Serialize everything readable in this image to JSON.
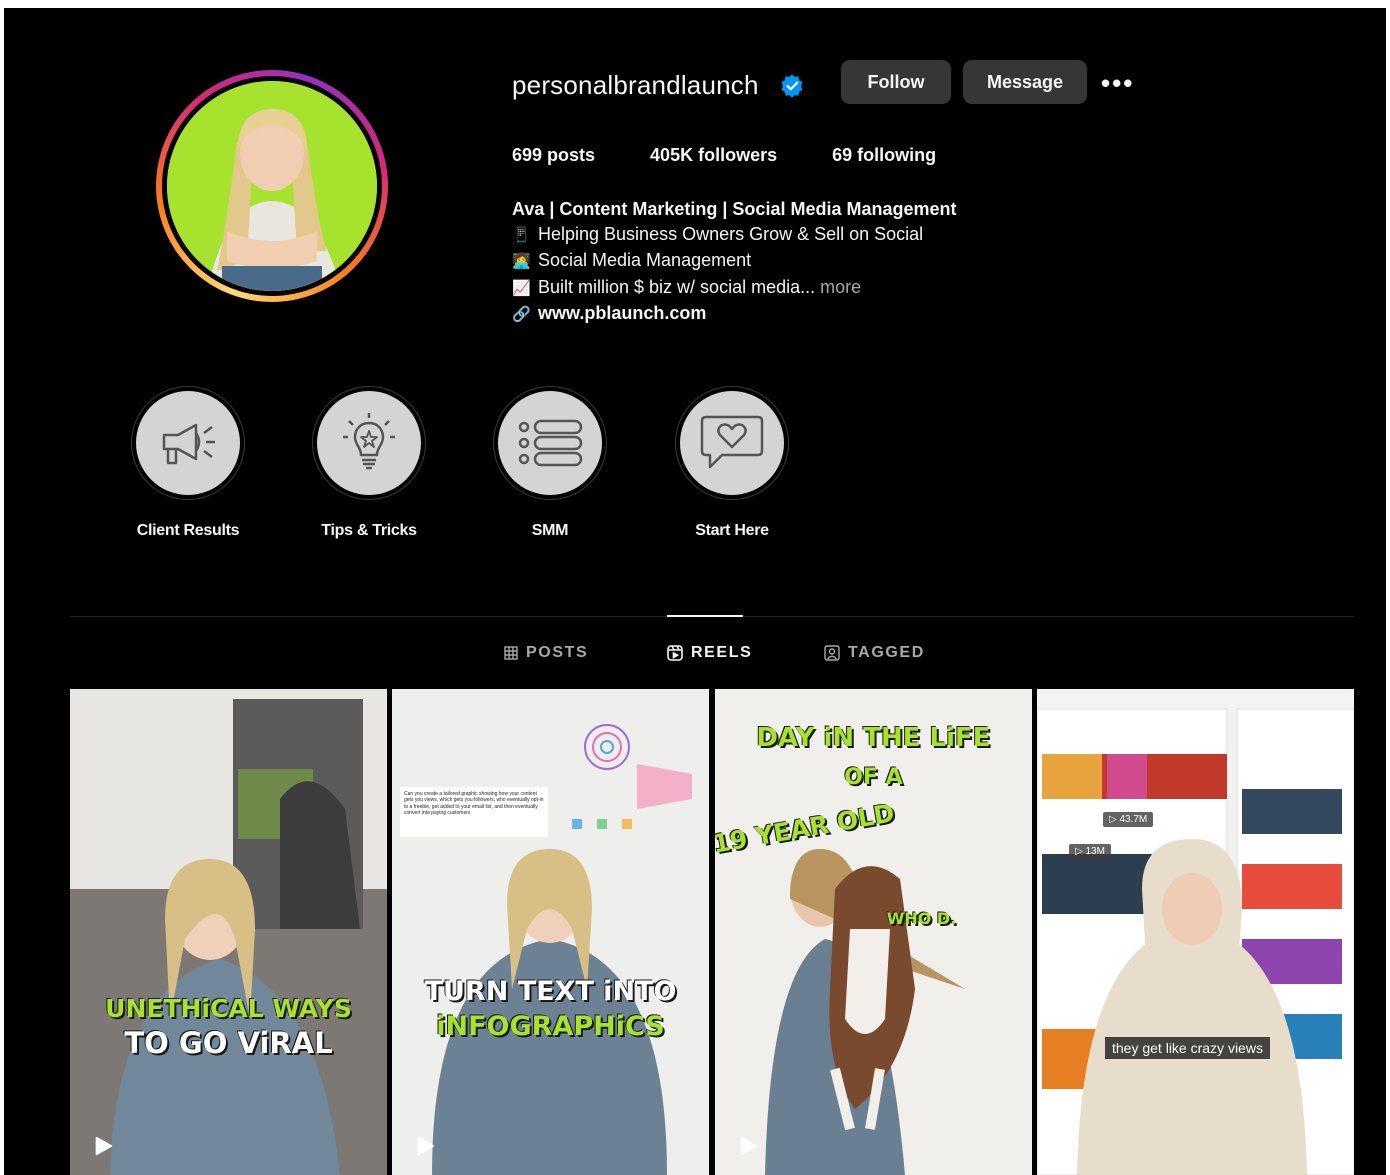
{
  "profile": {
    "username": "personalbrandlaunch",
    "follow_label": "Follow",
    "message_label": "Message",
    "more_label": "•••",
    "stats": {
      "posts": "699 posts",
      "followers": "405K followers",
      "following": "69 following"
    },
    "bio": {
      "name_line": "Ava | Content Marketing | Social Media Management",
      "line1": "Helping Business Owners Grow & Sell on Social",
      "line2": "Social Media Management",
      "line3": "Built million $ biz w/ social media...",
      "more": "more",
      "link": "www.pblaunch.com"
    }
  },
  "highlights": [
    {
      "label": "Client Results",
      "icon": "megaphone-icon"
    },
    {
      "label": "Tips & Tricks",
      "icon": "lightbulb-icon"
    },
    {
      "label": "SMM",
      "icon": "list-icon"
    },
    {
      "label": "Start Here",
      "icon": "heart-message-icon"
    }
  ],
  "tabs": [
    {
      "label": "POSTS",
      "active": false
    },
    {
      "label": "REELS",
      "active": true
    },
    {
      "label": "TAGGED",
      "active": false
    }
  ],
  "reels": [
    {
      "caption_line1": "UNETHiCAL WAYS",
      "caption_line2": "TO GO ViRAL"
    },
    {
      "caption_line1": "TURN TEXT iNTO",
      "caption_line2": "iNFOGRAPHiCS",
      "note": "Can you create a tailored graphic showing how your content gets you views, which gets you followers, who eventually opt-in to a freebie, get added to your email list, and then eventually convert into paying customers"
    },
    {
      "caption_line1": "DAY iN THE LiFE",
      "caption_line2": "OF A",
      "caption_line3": "19 YEAR OLD",
      "caption_line4": "WHO D."
    },
    {
      "caption": "they get like crazy views",
      "badge1": "▷ 43.7M",
      "badge2": "▷ 13M"
    }
  ],
  "colors": {
    "background": "#000000",
    "button": "#363636",
    "verified": "#0095f6",
    "avatar_bg": "#a6e22e",
    "caption_green": "#a6e22e"
  }
}
